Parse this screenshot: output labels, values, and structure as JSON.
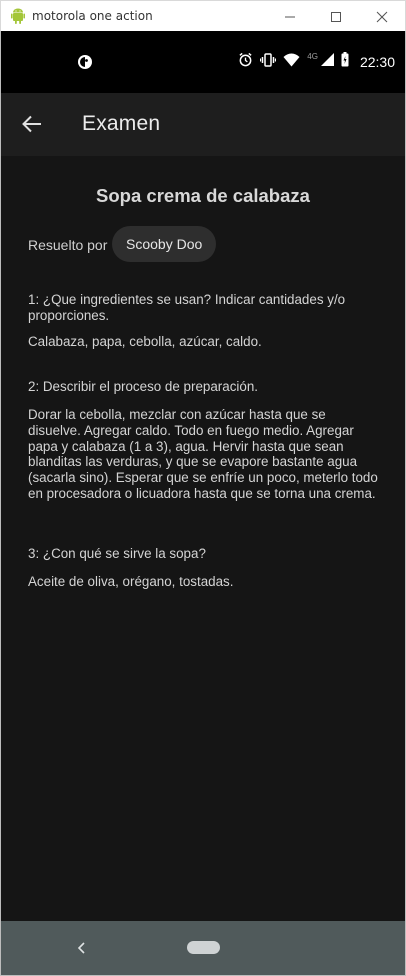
{
  "window": {
    "title": "motorola one action",
    "icons": {
      "app": "android-icon",
      "minimize": "minimize-icon",
      "maximize": "maximize-icon",
      "close": "close-icon"
    }
  },
  "status_bar": {
    "time": "22:30",
    "network": "4G",
    "icons": [
      "app-notification-icon",
      "alarm-icon",
      "vibrate-icon",
      "wifi-icon",
      "signal-icon",
      "battery-icon"
    ]
  },
  "toolbar": {
    "title": "Examen",
    "back_icon": "arrow-back-icon"
  },
  "recipe": {
    "title": "Sopa crema de calabaza",
    "resolved_by_label": "Resuelto por",
    "resolved_by_user": "Scooby Doo"
  },
  "questions": [
    {
      "question": "1: ¿Que ingredientes se usan? Indicar cantidades y/o proporciones.",
      "answer": "Calabaza, papa, cebolla, azúcar, caldo."
    },
    {
      "question": "2: Describir el proceso de preparación.",
      "answer": "Dorar la cebolla, mezclar con azúcar hasta que se disuelve. Agregar caldo. Todo en fuego medio. Agregar papa y calabaza (1 a 3), agua. Hervir hasta que sean blanditas las verduras, y que se evapore bastante agua (sacarla sino). Esperar que se enfríe un poco, meterlo todo en procesadora o licuadora hasta que se torna una crema."
    },
    {
      "question": "3: ¿Con qué se sirve la sopa?",
      "answer": "Aceite de oliva, orégano, tostadas."
    }
  ],
  "nav_bar": {
    "icons": [
      "nav-back-icon",
      "home-pill-icon"
    ]
  },
  "colors": {
    "app_background": "#151515",
    "toolbar_background": "#1e1e1e",
    "chip_background": "#2e2e2e",
    "nav_bar_background": "#505a5b",
    "android_green": "#a4c639"
  }
}
